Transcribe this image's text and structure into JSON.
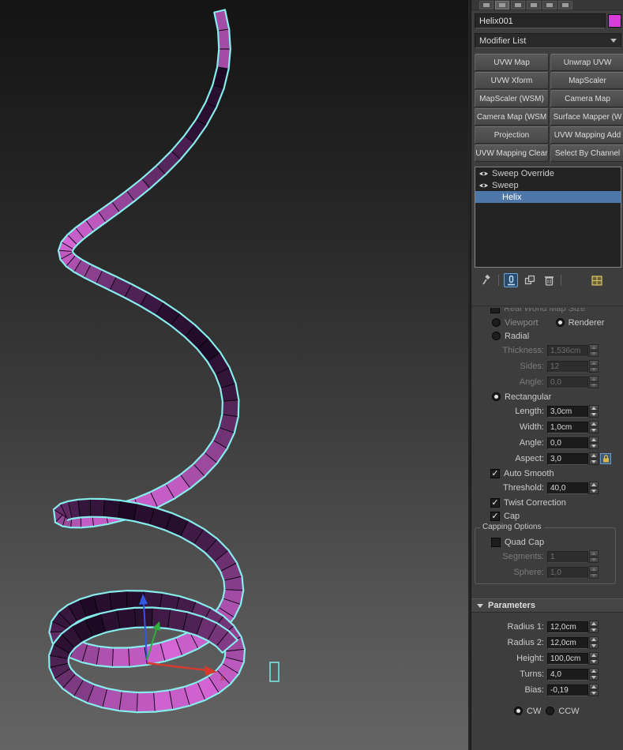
{
  "colors": {
    "object_color": "#d93cd9",
    "ribbon_bright": "#db68db",
    "ribbon_dark": "#12041a",
    "selection_outline": "#86ecec",
    "stack_highlight": "#4d77a8",
    "axis_x": "#d63a2f",
    "axis_y": "#2fae3f",
    "axis_z": "#2e59e0"
  },
  "viewport": {
    "axis_label": "x",
    "helix_params": {
      "turns": 4,
      "radius1": 12,
      "radius2": 12,
      "height": 100,
      "bias": -0.19
    }
  },
  "panel": {
    "object_name": "Helix001",
    "modifier_list_label": "Modifier List",
    "tabs": [
      "create",
      "modify",
      "hierarchy",
      "motion",
      "display",
      "utilities"
    ],
    "modifier_buttons": [
      "UVW Map",
      "Unwrap UVW",
      "UVW Xform",
      "MapScaler",
      "MapScaler (WSM)",
      "Camera Map",
      "Camera Map (WSM",
      "Surface Mapper (W",
      "Projection",
      "UVW Mapping Add",
      "UVW Mapping Clear",
      "Select By Channel"
    ],
    "stack_items": [
      {
        "label": "Sweep Override",
        "eye": true,
        "selected": false
      },
      {
        "label": "Sweep",
        "eye": true,
        "selected": false
      },
      {
        "label": "Helix",
        "eye": false,
        "selected": true
      }
    ],
    "stack_toolbar": [
      "pin-stack",
      "show-end-result",
      "make-unique",
      "remove-modifier",
      "configure-modifier-sets"
    ],
    "sweep_rows": [
      {
        "type": "check",
        "label": "Real World Map Size",
        "checked": false,
        "enabled": false,
        "clipped": true
      },
      {
        "type": "radio2",
        "items": [
          {
            "label": "Viewport",
            "selected": false,
            "enabled": false
          },
          {
            "label": "Renderer",
            "selected": true,
            "enabled": true
          }
        ]
      },
      {
        "type": "radio",
        "label": "Radial",
        "selected": false
      },
      {
        "type": "field",
        "label": "Thickness:",
        "value": "1,536cm",
        "enabled": false
      },
      {
        "type": "field",
        "label": "Sides:",
        "value": "12",
        "enabled": false
      },
      {
        "type": "field",
        "label": "Angle:",
        "value": "0,0",
        "enabled": false
      },
      {
        "type": "radio",
        "label": "Rectangular",
        "selected": true
      },
      {
        "type": "field",
        "label": "Length:",
        "value": "3,0cm",
        "enabled": true
      },
      {
        "type": "field",
        "label": "Width:",
        "value": "1,0cm",
        "enabled": true
      },
      {
        "type": "field",
        "label": "Angle:",
        "value": "0,0",
        "enabled": true
      },
      {
        "type": "field",
        "label": "Aspect:",
        "value": "3,0",
        "enabled": true,
        "lock": true
      },
      {
        "type": "check",
        "label": "Auto Smooth",
        "checked": true,
        "enabled": true
      },
      {
        "type": "field",
        "label": "Threshold:",
        "value": "40,0",
        "enabled": true
      },
      {
        "type": "check",
        "label": "Twist Correction",
        "checked": true,
        "enabled": true
      },
      {
        "type": "check",
        "label": "Cap",
        "checked": true,
        "enabled": true
      },
      {
        "type": "group",
        "title": "Capping Options",
        "rows": [
          {
            "type": "check",
            "label": "Quad Cap",
            "checked": false,
            "enabled": true
          },
          {
            "type": "field",
            "label": "Segments:",
            "value": "1",
            "enabled": false
          },
          {
            "type": "field",
            "label": "Sphere:",
            "value": "1,0",
            "enabled": false
          }
        ]
      }
    ],
    "parameters_rollout": {
      "title": "Parameters",
      "rows": [
        {
          "type": "field",
          "label": "Radius 1:",
          "value": "12,0cm",
          "enabled": true
        },
        {
          "type": "field",
          "label": "Radius 2:",
          "value": "12,0cm",
          "enabled": true
        },
        {
          "type": "field",
          "label": "Height:",
          "value": "100,0cm",
          "enabled": true
        },
        {
          "type": "field",
          "label": "Turns:",
          "value": "4,0",
          "enabled": true
        },
        {
          "type": "field",
          "label": "Bias:",
          "value": "-0,19",
          "enabled": true
        },
        {
          "type": "radio2",
          "center": true,
          "items": [
            {
              "label": "CW",
              "selected": true,
              "enabled": true
            },
            {
              "label": "CCW",
              "selected": false,
              "enabled": true
            }
          ]
        }
      ]
    }
  }
}
